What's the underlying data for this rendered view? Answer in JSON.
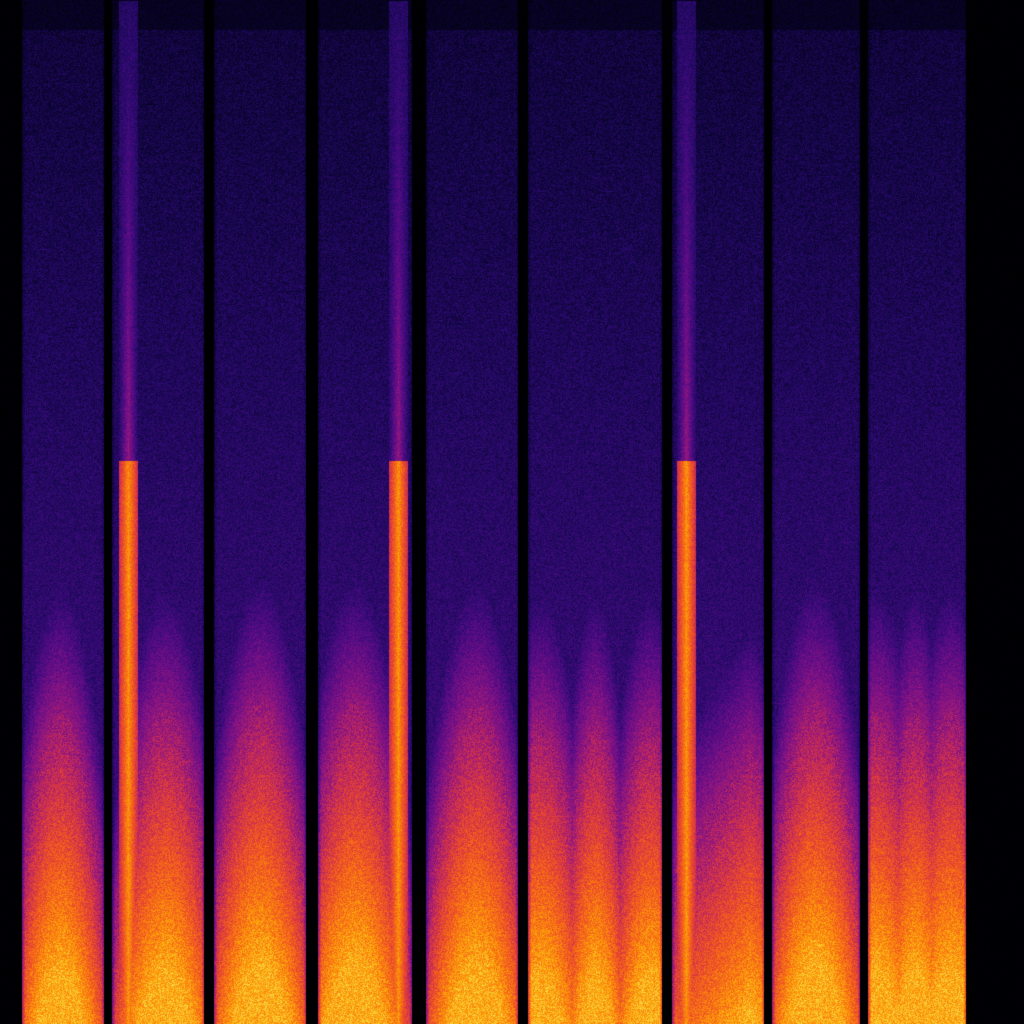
{
  "visualization": {
    "kind": "spectrogram",
    "colormap": [
      "#000000",
      "#0b0433",
      "#2a0a6e",
      "#5a0c86",
      "#8f1680",
      "#c42a58",
      "#e8472e",
      "#f86f14",
      "#fca50a",
      "#f7e04a"
    ],
    "background_color": "#000000",
    "segment_count": 10,
    "segments": [
      {
        "index": 1,
        "shape": "dome",
        "narrow_spike": false
      },
      {
        "index": 2,
        "shape": "dome",
        "narrow_spike": true
      },
      {
        "index": 3,
        "shape": "dome",
        "narrow_spike": false
      },
      {
        "index": 4,
        "shape": "dome",
        "narrow_spike": true
      },
      {
        "index": 5,
        "shape": "dome",
        "narrow_spike": false
      },
      {
        "index": 6,
        "shape": "double-peak",
        "narrow_spike": false
      },
      {
        "index": 7,
        "shape": "ramp-up",
        "narrow_spike": true
      },
      {
        "index": 8,
        "shape": "dome",
        "narrow_spike": false
      },
      {
        "index": 9,
        "shape": "double-peak",
        "narrow_spike": false
      },
      {
        "index": 10,
        "shape": "none",
        "narrow_spike": false
      }
    ]
  }
}
